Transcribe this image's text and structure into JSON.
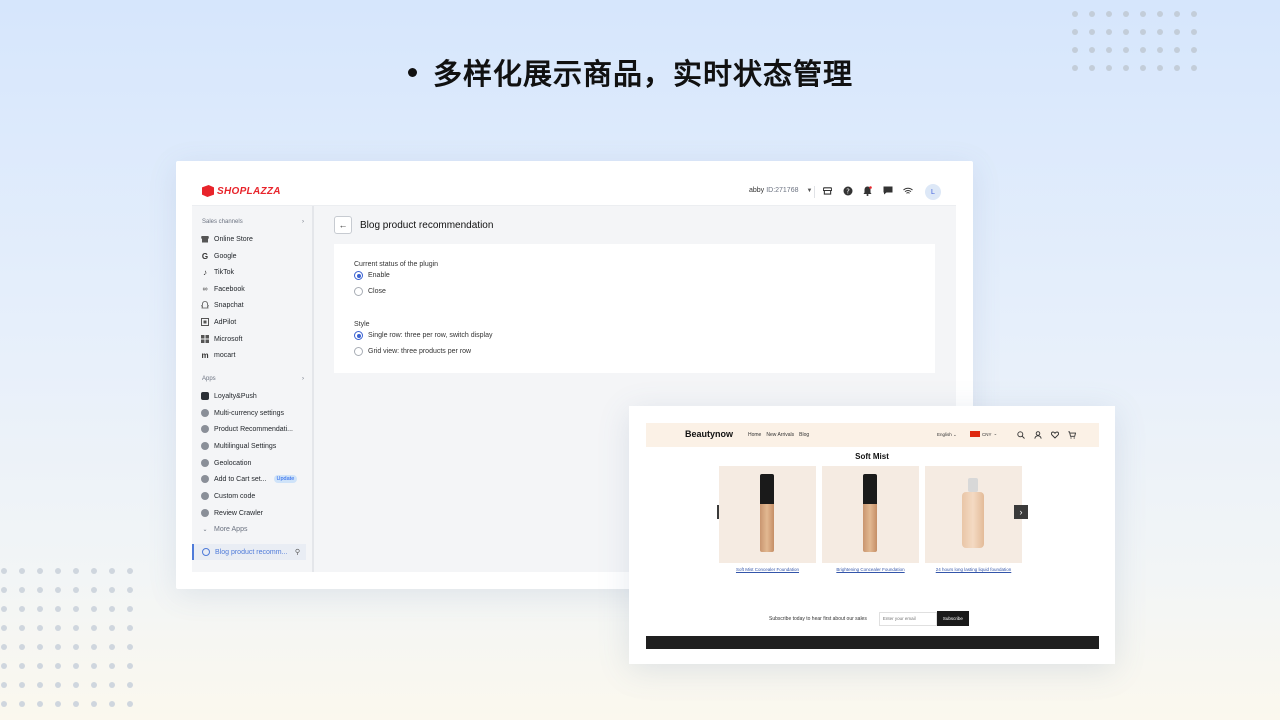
{
  "headline": "多样化展示商品，实时状态管理",
  "admin": {
    "logo_text": "SHOPLAZZA",
    "account_name": "abby",
    "account_id": "ID:271768",
    "avatar_initial": "L",
    "sidebar": {
      "sales_channels_label": "Sales channels",
      "channels": [
        "Online Store",
        "Google",
        "TikTok",
        "Facebook",
        "Snapchat",
        "AdPilot",
        "Microsoft",
        "mocart"
      ],
      "apps_label": "Apps",
      "apps": [
        "Loyalty&Push",
        "Multi-currency settings",
        "Product Recommendati...",
        "Multilingual Settings",
        "Geolocation",
        "Add to Cart set...",
        "Custom code",
        "Review Crawler"
      ],
      "update_badge": "Update",
      "more_apps": "More Apps",
      "active_item": "Blog product recomm..."
    },
    "page_title": "Blog product recommendation",
    "status_label": "Current status of the plugin",
    "status_options": [
      "Enable",
      "Close"
    ],
    "status_selected": "Enable",
    "style_label": "Style",
    "style_options": [
      "Single row: three per row, switch display",
      "Grid view: three products per row"
    ],
    "style_selected": "Single row: three per row, switch display"
  },
  "store": {
    "brand": "Beautynow",
    "nav": [
      "Home",
      "New Arrivals",
      "Blog"
    ],
    "language": "English",
    "currency": "CNY",
    "section_title": "Soft Mist",
    "products": [
      "Soft Mist Concealer Foundation",
      "Brightening Concealer Foundation",
      "24 hours long lasting liquid foundation"
    ],
    "subscribe_text": "Subscribe today to hear first about our sales",
    "email_placeholder": "Enter your email",
    "subscribe_button": "Subscribe"
  },
  "colors": {
    "accent": "#3b62d1",
    "brand_red": "#e8242b",
    "store_header_bg": "#fbf1e6"
  }
}
